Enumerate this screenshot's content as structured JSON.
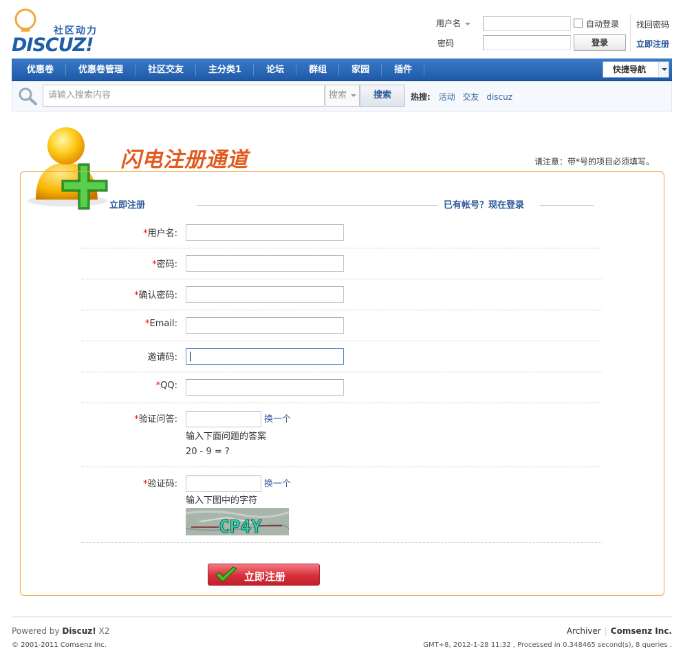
{
  "logo": {
    "tagline": "社区动力",
    "wordmark": "DISCUZ!"
  },
  "login": {
    "username_label": "用户名",
    "password_label": "密码",
    "auto_login": "自动登录",
    "login_button": "登录",
    "find_password": "找回密码",
    "register_now": "立即注册"
  },
  "nav": {
    "items": [
      "优惠卷",
      "优惠卷管理",
      "社区交友",
      "主分类1",
      "论坛",
      "群组",
      "家园",
      "插件"
    ],
    "quick_nav": "快捷导航"
  },
  "search": {
    "placeholder": "请输入搜索内容",
    "type": "搜索",
    "button": "搜索",
    "hot_label": "热搜:",
    "hot_items": [
      "活动",
      "交友",
      "discuz"
    ]
  },
  "register": {
    "title": "闪电注册通道",
    "notice": "请注意：带*号的项目必须填写。",
    "tab_register": "立即注册",
    "tab_login": "已有帐号？现在登录",
    "required_mark": "*",
    "fields": {
      "username": "用户名:",
      "password": "密码:",
      "confirm_password": "确认密码:",
      "email": "Email:",
      "invite_code": "邀请码:",
      "qq": "QQ:",
      "verify_question": "验证问答:",
      "verify_code": "验证码:"
    },
    "change_link": "换一个",
    "question_hint": "输入下面问题的答案",
    "question": "20 - 9 = ?",
    "captcha_hint": "输入下图中的字符",
    "captcha_text": "CP4Y",
    "submit": "立即注册"
  },
  "footer": {
    "powered_prefix": "Powered by ",
    "powered_brand": "Discuz!",
    "powered_version": " X2",
    "copyright": "© 2001-2011 Comsenz Inc.",
    "archiver": "Archiver",
    "company": "Comsenz Inc.",
    "stats": "GMT+8, 2012-1-28 11:32 , Processed in 0.348465 second(s), 8 queries ."
  },
  "colors": {
    "nav_blue": "#1e5aa6",
    "title_orange": "#e35a1e",
    "link_blue": "#2b5998",
    "box_border": "#f0a642",
    "submit_red": "#d72f3b"
  }
}
